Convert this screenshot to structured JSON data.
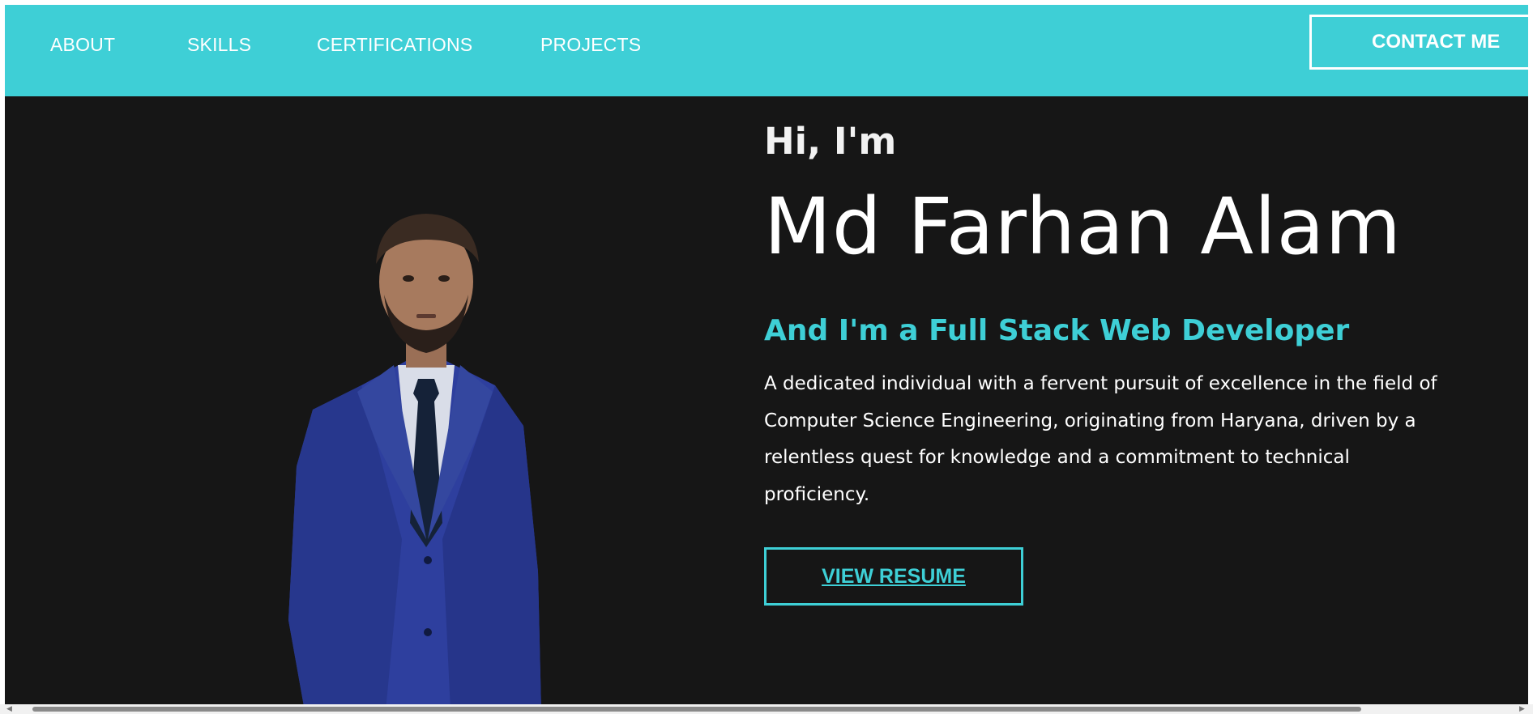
{
  "nav": {
    "links": [
      "ABOUT",
      "SKILLS",
      "CERTIFICATIONS",
      "PROJECTS"
    ],
    "contact_label": "CONTACT ME"
  },
  "hero": {
    "greeting": "Hi, I'm",
    "name": "Md Farhan Alam",
    "role": "And I'm a Full Stack Web Developer",
    "bio": "A dedicated individual with a fervent pursuit of excellence in the field of Computer Science Engineering, originating from Haryana, driven by a relentless quest for knowledge and a commitment to technical proficiency.",
    "resume_label": "VIEW RESUME"
  },
  "colors": {
    "accent": "#3ecfd6",
    "background": "#161616",
    "text": "#ffffff"
  },
  "icons": {
    "scroll_left": "scroll-left-arrow-icon",
    "scroll_right": "scroll-right-arrow-icon"
  }
}
